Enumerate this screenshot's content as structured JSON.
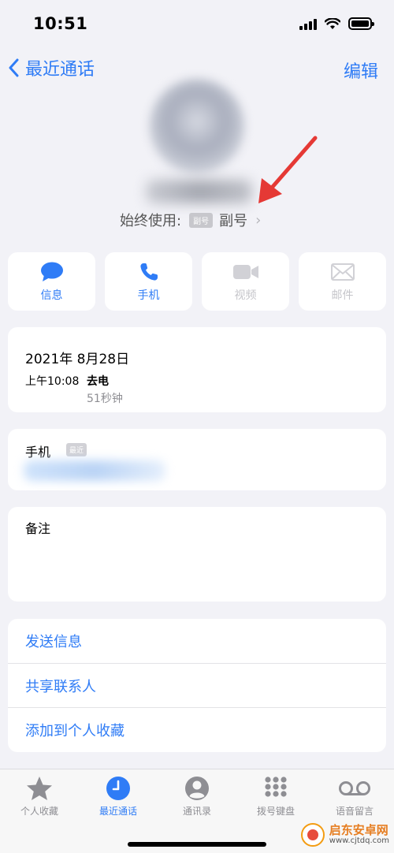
{
  "status_bar": {
    "time": "10:51"
  },
  "nav": {
    "back_label": "最近通话",
    "edit_label": "编辑"
  },
  "contact": {
    "always_use_label": "始终使用:",
    "sim_badge": "副号",
    "sim_name": "副号",
    "chevron": "›"
  },
  "actions": [
    {
      "label": "信息",
      "icon": "message-bubble-icon",
      "enabled": true
    },
    {
      "label": "手机",
      "icon": "phone-icon",
      "enabled": true
    },
    {
      "label": "视频",
      "icon": "video-camera-icon",
      "enabled": false
    },
    {
      "label": "邮件",
      "icon": "mail-envelope-icon",
      "enabled": false
    }
  ],
  "call_log": {
    "date": "2021年 8月28日",
    "time": "上午10:08",
    "type": "去电",
    "duration": "51秒钟"
  },
  "phone": {
    "label": "手机",
    "badge": "最近"
  },
  "notes": {
    "label": "备注"
  },
  "links": [
    "发送信息",
    "共享联系人",
    "添加到个人收藏"
  ],
  "tabs": [
    {
      "label": "个人收藏",
      "icon": "star-icon",
      "active": false
    },
    {
      "label": "最近通话",
      "icon": "clock-icon",
      "active": true
    },
    {
      "label": "通讯录",
      "icon": "person-icon",
      "active": false
    },
    {
      "label": "拨号键盘",
      "icon": "keypad-icon",
      "active": false
    },
    {
      "label": "语音留言",
      "icon": "voicemail-icon",
      "active": false
    }
  ],
  "watermark": {
    "title": "启东安卓网",
    "url": "www.cjtdq.com"
  },
  "colors": {
    "accent": "#2f7cf6",
    "background": "#f2f2f7",
    "disabled": "#c5c5ca",
    "annotation": "#e53935"
  }
}
